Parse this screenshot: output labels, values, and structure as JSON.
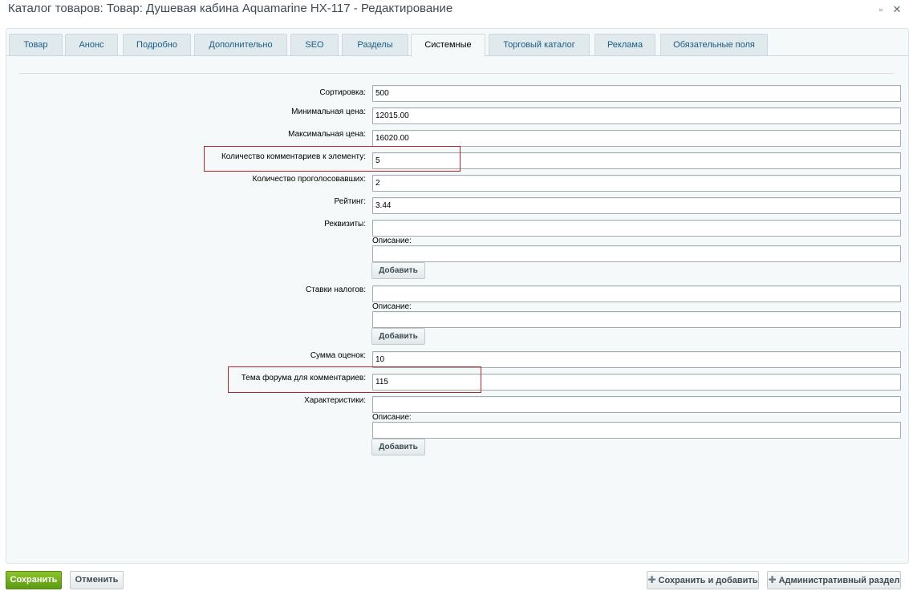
{
  "window": {
    "title": "Каталог товаров: Товар: Душевая кабина Aquamarine HX-117 - Редактирование",
    "restore_icon": "restore-icon",
    "close_icon": "close-icon",
    "restore_glyph": "▫",
    "close_glyph": "✕"
  },
  "tabs": [
    {
      "label": "Товар"
    },
    {
      "label": "Анонс"
    },
    {
      "label": "Подробно"
    },
    {
      "label": "Дополнительно"
    },
    {
      "label": "SEO"
    },
    {
      "label": "Разделы"
    },
    {
      "label": "Системные",
      "active": true
    },
    {
      "label": "Торговый каталог"
    },
    {
      "label": "Реклама"
    },
    {
      "label": "Обязательные поля"
    }
  ],
  "form": {
    "sort": {
      "label": "Сортировка:",
      "value": "500"
    },
    "min_price": {
      "label": "Минимальная цена:",
      "value": "12015.00"
    },
    "max_price": {
      "label": "Максимальная цена:",
      "value": "16020.00"
    },
    "comments_count": {
      "label": "Количество комментариев к элементу:",
      "value": "5"
    },
    "votes_count": {
      "label": "Количество проголосовавших:",
      "value": "2"
    },
    "rating": {
      "label": "Рейтинг:",
      "value": "3.44"
    },
    "requisites": {
      "label": "Реквизиты:",
      "value": "",
      "desc_label": "Описание:",
      "desc_value": "",
      "add_label": "Добавить"
    },
    "tax_rates": {
      "label": "Ставки налогов:",
      "value": "",
      "desc_label": "Описание:",
      "desc_value": "",
      "add_label": "Добавить"
    },
    "rating_sum": {
      "label": "Сумма оценок:",
      "value": "10"
    },
    "forum_topic": {
      "label": "Тема форума для комментариев:",
      "value": "115"
    },
    "characteristics": {
      "label": "Характеристики:",
      "value": "",
      "desc_label": "Описание:",
      "desc_value": "",
      "add_label": "Добавить"
    }
  },
  "highlight_color": "#b3262a",
  "footer": {
    "save_label": "Сохранить",
    "cancel_label": "Отменить",
    "save_add_label": "Сохранить и добавить",
    "admin_label": "Административный раздел",
    "plus_glyph": "✚"
  },
  "colors": {
    "accent": "#5b9a12",
    "tab_text": "#1a5c87",
    "panel_bg": "#f5f9f9"
  }
}
